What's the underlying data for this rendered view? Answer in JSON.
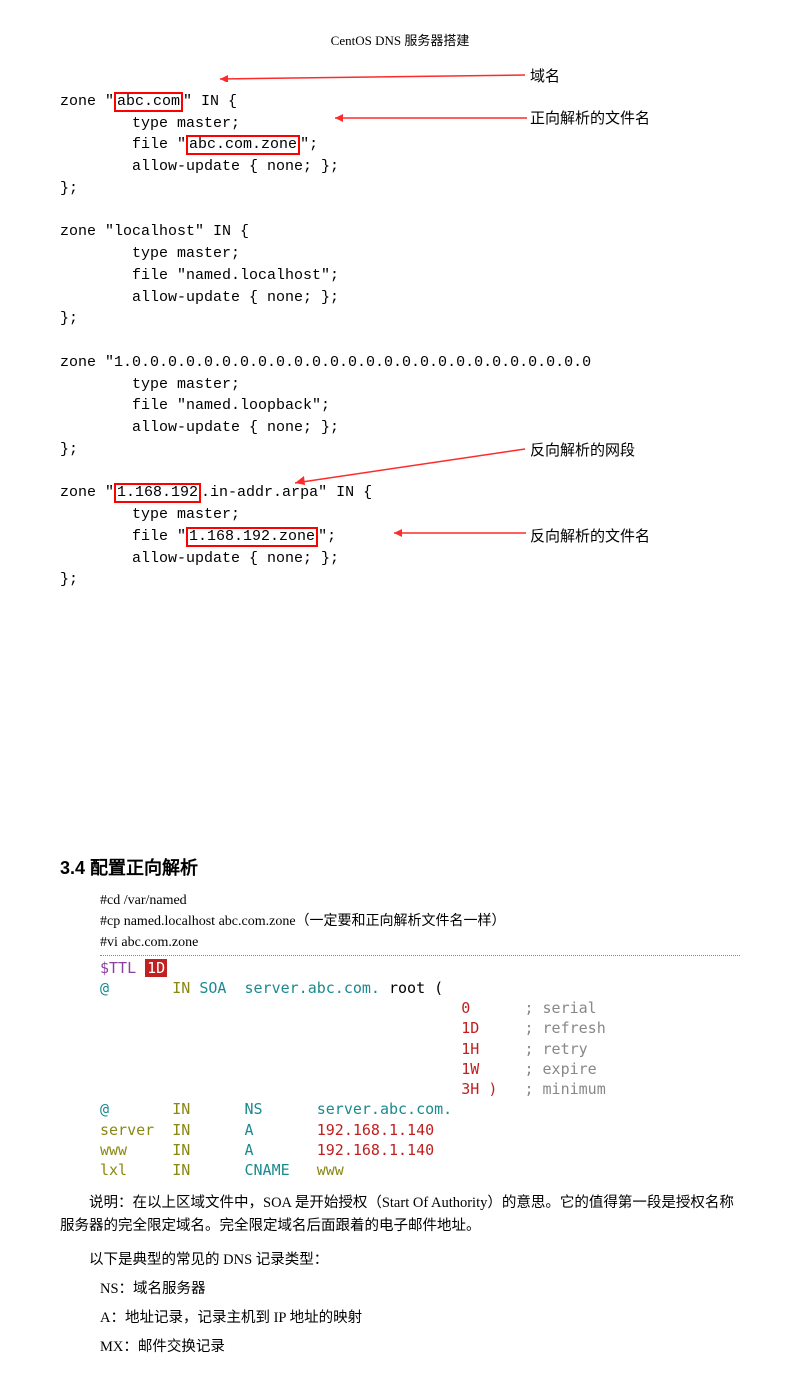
{
  "doc_title": "CentOS DNS 服务器搭建",
  "config": {
    "zone1": {
      "keyword_zone": "zone ",
      "q1": "\"",
      "domain": "abc.com",
      "q2": "\" IN {",
      "type": "        type master;",
      "file_pre": "        file \"",
      "file_name": "abc.com.zone",
      "file_post": "\";",
      "allow": "        allow-update { none; };",
      "close": "};"
    },
    "zone2": {
      "l1": "zone \"localhost\" IN {",
      "l2": "        type master;",
      "l3": "        file \"named.localhost\";",
      "l4": "        allow-update { none; };",
      "l5": "};"
    },
    "zone3": {
      "l1": "zone \"1.0.0.0.0.0.0.0.0.0.0.0.0.0.0.0.0.0.0.0.0.0.0.0.0.0.0",
      "l2": "        type master;",
      "l3": "        file \"named.loopback\";",
      "l4": "        allow-update { none; };",
      "l5": "};"
    },
    "zone4": {
      "keyword_zone": "zone ",
      "q1": "\"",
      "net": "1.168.192",
      "mid": ".in-addr.arpa\" IN {",
      "type": "        type master;",
      "file_pre": "        file \"",
      "file_name": "1.168.192.zone",
      "file_post": "\";",
      "allow": "        allow-update { none; };",
      "close": "};"
    }
  },
  "annotations": {
    "a1": "域名",
    "a2": "正向解析的文件名",
    "a3": "反向解析的网段",
    "a4": "反向解析的文件名"
  },
  "section_heading": "3.4 配置正向解析",
  "cmds": {
    "c1": "#cd /var/named",
    "c2": "#cp named.localhost abc.com.zone（一定要和正向解析文件名一样）",
    "c3": "#vi abc.com.zone"
  },
  "zonefile": {
    "ttl_lbl": "$TTL ",
    "ttl_val": "1D",
    "at1": "@",
    "in1": "IN",
    "soa": "SOA",
    "soa_host": "server.abc.com.",
    "root": "root (",
    "s_serial_v": "0",
    "s_serial_c": "; serial",
    "s_refresh_v": "1D",
    "s_refresh_c": "; refresh",
    "s_retry_v": "1H",
    "s_retry_c": "; retry",
    "s_expire_v": "1W",
    "s_expire_c": "; expire",
    "s_min_v": "3H )",
    "s_min_c": "; minimum",
    "r1_h": "@",
    "r1_in": "IN",
    "r1_t": "NS",
    "r1_v": "server.abc.com.",
    "r2_h": "server",
    "r2_in": "IN",
    "r2_t": "A",
    "r2_v": "192.168.1.140",
    "r3_h": "www",
    "r3_in": "IN",
    "r3_t": "A",
    "r3_v": "192.168.1.140",
    "r4_h": "lxl",
    "r4_in": "IN",
    "r4_t": "CNAME",
    "r4_v": "www"
  },
  "explain": {
    "p1": "说明：在以上区域文件中，SOA 是开始授权（Start  Of Authority）的意思。它的值得第一段是授权名称服务器的完全限定域名。完全限定域名后面跟着的电子邮件地址。",
    "p2": "以下是典型的常见的 DNS 记录类型：",
    "ns": "NS：域名服务器",
    "a": "A：地址记录，记录主机到 IP 地址的映射",
    "mx": "MX：邮件交换记录"
  }
}
